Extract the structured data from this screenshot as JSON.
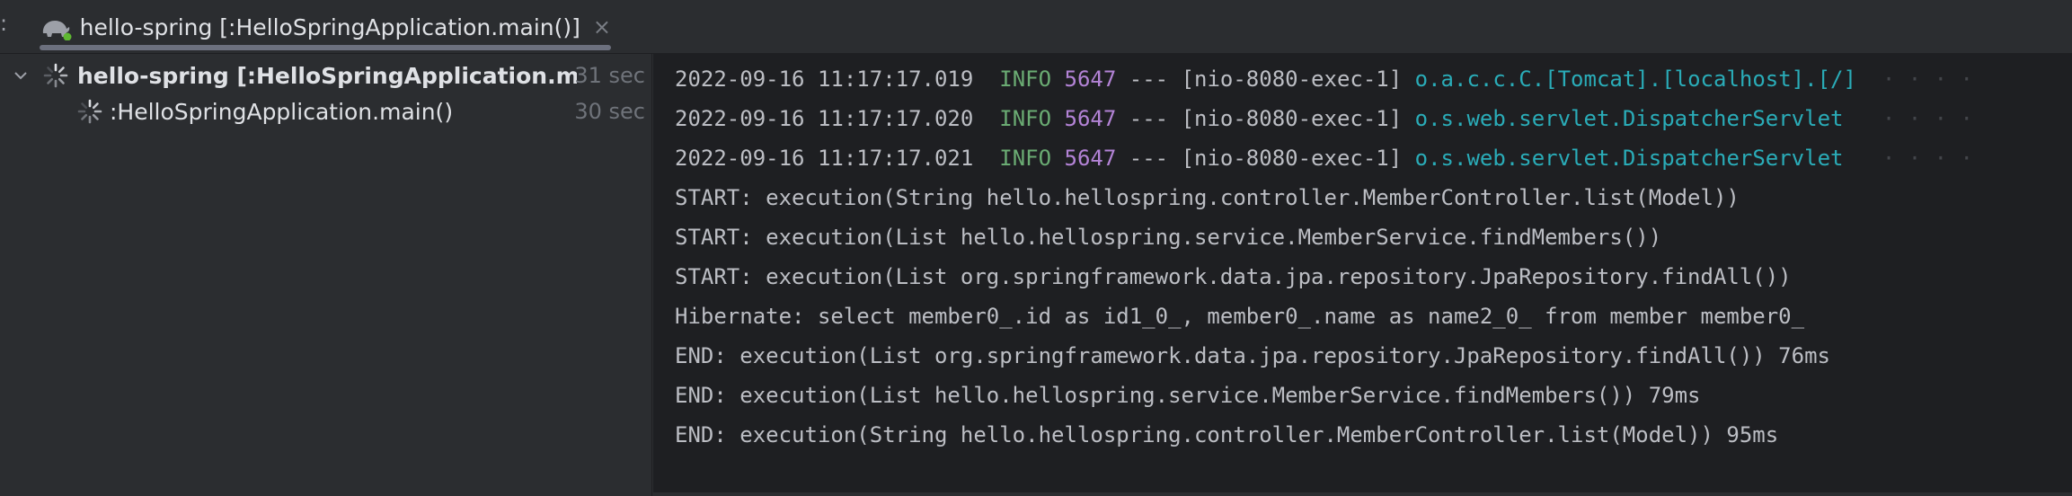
{
  "tabbar": {
    "prefix": ":",
    "tab_label": "hello-spring [:HelloSpringApplication.main()]",
    "close_glyph": "×",
    "icon": "gradle-elephant-icon"
  },
  "tree": {
    "items": [
      {
        "label": "hello-spring [:HelloSpringApplication.main",
        "time": "31 sec",
        "icon": "spinner-icon",
        "expanded": true
      },
      {
        "label": ":HelloSpringApplication.main()",
        "time": "30 sec",
        "icon": "spinner-icon"
      }
    ]
  },
  "console": {
    "log_lines": [
      {
        "timestamp": "2022-09-16 11:17:17.019",
        "level": "INFO",
        "pid": "5647",
        "separator": "---",
        "thread": "[nio-8080-exec-1]",
        "logger": "o.a.c.c.C.[Tomcat].[localhost].[/]"
      },
      {
        "timestamp": "2022-09-16 11:17:17.020",
        "level": "INFO",
        "pid": "5647",
        "separator": "---",
        "thread": "[nio-8080-exec-1]",
        "logger": "o.s.web.servlet.DispatcherServlet"
      },
      {
        "timestamp": "2022-09-16 11:17:17.021",
        "level": "INFO",
        "pid": "5647",
        "separator": "---",
        "thread": "[nio-8080-exec-1]",
        "logger": "o.s.web.servlet.DispatcherServlet"
      }
    ],
    "plain_lines": [
      "START: execution(String hello.hellospring.controller.MemberController.list(Model))",
      "START: execution(List hello.hellospring.service.MemberService.findMembers())",
      "START: execution(List org.springframework.data.jpa.repository.JpaRepository.findAll())",
      "Hibernate: select member0_.id as id1_0_, member0_.name as name2_0_ from member member0_",
      "END: execution(List org.springframework.data.jpa.repository.JpaRepository.findAll()) 76ms",
      "END: execution(List hello.hellospring.service.MemberService.findMembers()) 79ms",
      "END: execution(String hello.hellospring.controller.MemberController.list(Model)) 95ms"
    ],
    "colors": {
      "level": "#6aab73",
      "pid": "#b383d6",
      "logger": "#2aacb8"
    }
  }
}
